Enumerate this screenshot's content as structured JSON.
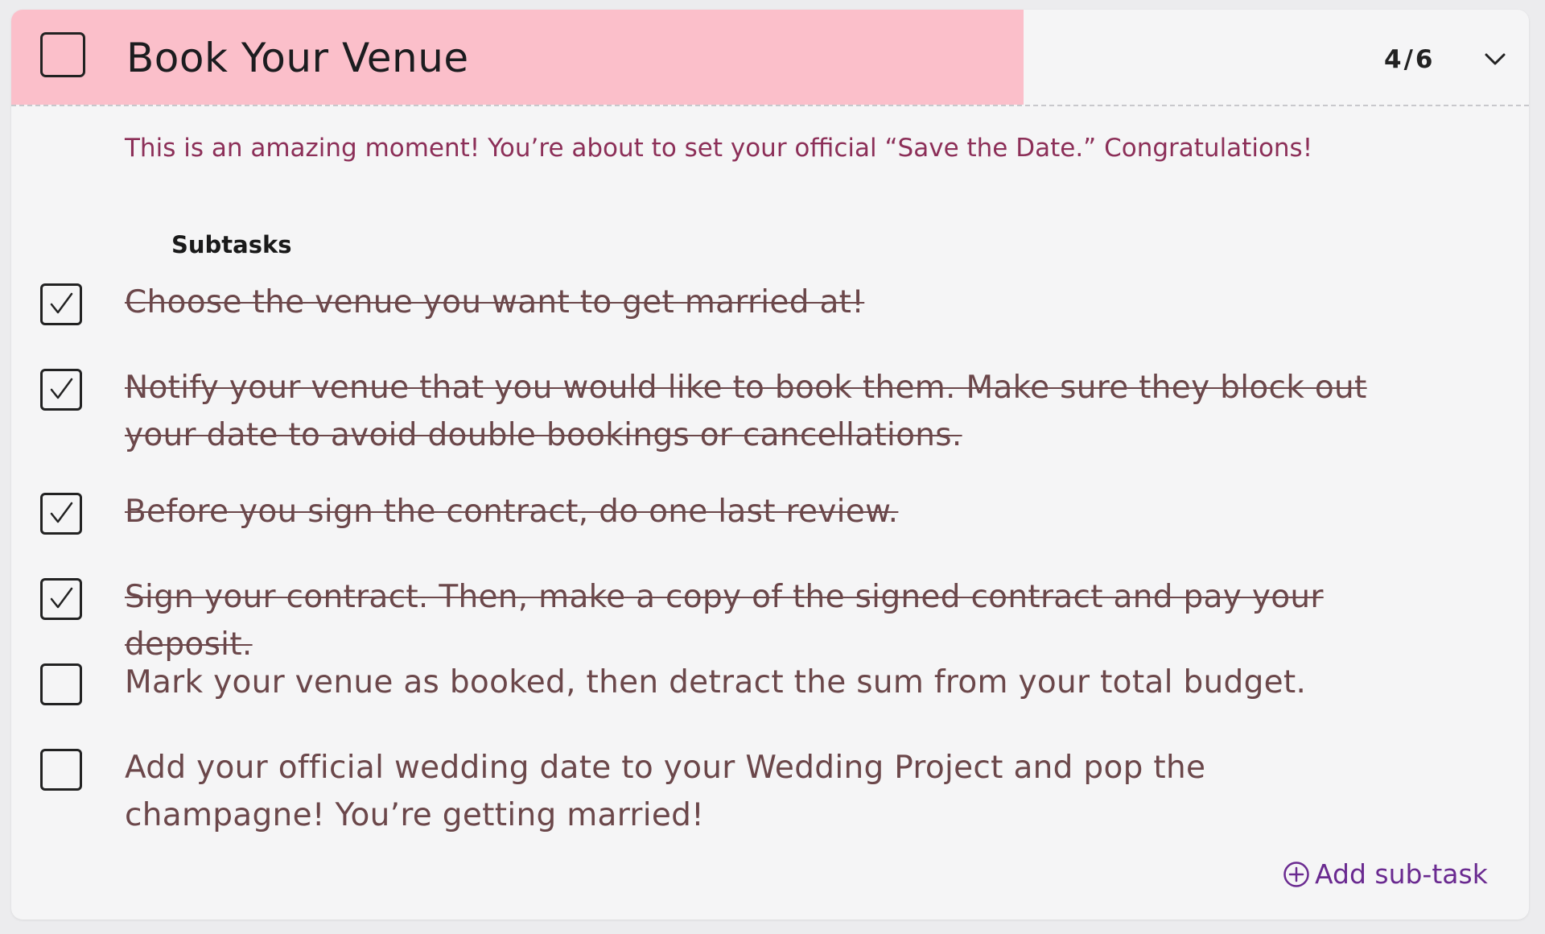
{
  "task": {
    "title": "Book Your Venue",
    "progress_text": "4/6",
    "progress_fraction": 0.667,
    "checked": false,
    "description": "This is an amazing moment! You’re about to set your official “Save the Date.” Congratulations!"
  },
  "subtasks_heading": "Subtasks",
  "subtasks": [
    {
      "text": "Choose the venue you want to get married at!",
      "checked": true
    },
    {
      "text": "Notify your venue that you would like to book them. Make sure they block out your date to avoid double bookings or cancellations.",
      "checked": true
    },
    {
      "text": "Before you sign the contract, do one last review.",
      "checked": true
    },
    {
      "text": "Sign your contract. Then, make a copy of the signed contract and pay your deposit.",
      "checked": true
    },
    {
      "text": "Mark your venue as booked, then detract the sum from your total budget.",
      "checked": false
    },
    {
      "text": "Add your official wedding date to your Wedding Project and pop the champagne! You’re getting married!",
      "checked": false
    }
  ],
  "add_subtask_label": "Add sub-task",
  "icons": {
    "checkmark": "checkmark-icon",
    "chevron": "chevron-down-icon",
    "add": "plus-circle-icon"
  },
  "colors": {
    "progress_fill": "#fbbfca",
    "description": "#8c2f58",
    "subtask_text": "#6b474a",
    "accent": "#6a2a90"
  }
}
